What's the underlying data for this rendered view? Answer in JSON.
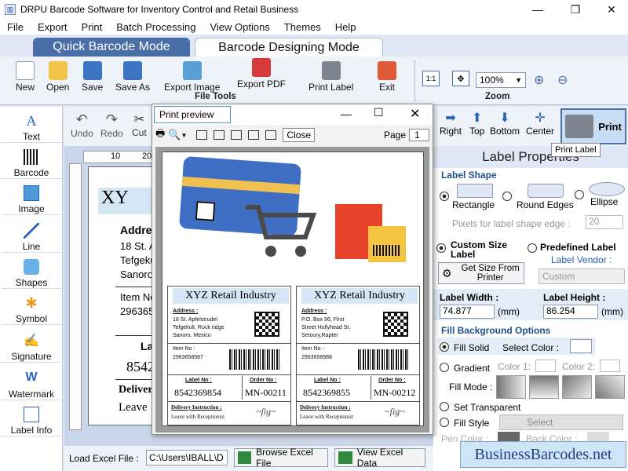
{
  "window": {
    "title": "DRPU Barcode Software for Inventory Control and Retail Business"
  },
  "menu": [
    "File",
    "Export",
    "Print",
    "Batch Processing",
    "View Options",
    "Themes",
    "Help"
  ],
  "modes": {
    "quick": "Quick Barcode Mode",
    "designing": "Barcode Designing Mode"
  },
  "file_tools": {
    "group": "File Tools",
    "new": "New",
    "open": "Open",
    "save": "Save",
    "save_as": "Save As",
    "export_image": "Export Image",
    "export_pdf": "Export PDF",
    "print_label": "Print Label",
    "exit": "Exit"
  },
  "zoom": {
    "group": "Zoom",
    "value": "100%"
  },
  "edit_tools": {
    "undo": "Undo",
    "redo": "Redo",
    "cut": "Cut"
  },
  "nav_tools": {
    "right": "Right",
    "top": "Top",
    "bottom": "Bottom",
    "center": "Center",
    "print": "Print",
    "tooltip": "Print Label"
  },
  "left_tools": [
    "Text",
    "Barcode",
    "Image",
    "Line",
    "Shapes",
    "Symbol",
    "Signature",
    "Watermark",
    "Label Info"
  ],
  "ruler": {
    "marks": [
      "10",
      "20"
    ]
  },
  "canvas": {
    "company_prefix": "XY",
    "address_prefix": "Addres",
    "addr1": "18 St. A",
    "addr2": "Tefgeku",
    "addr3": "Sanoro",
    "item_prefix": "Item No",
    "item_val": "296365",
    "label_prefix": "La",
    "label_val": "8542",
    "delivery_prefix": "Deliver",
    "leave_prefix": "Leave"
  },
  "preview": {
    "title": "Print preview",
    "close": "Close",
    "page_label": "Page",
    "page_value": "1"
  },
  "labels": [
    {
      "company": "XYZ Retail Industry",
      "address_label": "Address :",
      "address_lines": [
        "18 St. Apfelstrudel",
        "Tefgekult, Rock ridge",
        "Sanoro, Mexico"
      ],
      "item_label": "Item No :",
      "item_no": "2963658987",
      "label_no_label": "Label No :",
      "label_no": "8542369854",
      "order_no_label": "Order No :",
      "order_no": "MN-00211",
      "delivery_label": "Delivery Instruction :",
      "delivery_text": "Leave with Receptionist"
    },
    {
      "company": "XYZ Retail Industry",
      "address_label": "Address :",
      "address_lines": [
        "P.O. Box 96, First",
        "Street Hollyhead St.",
        "Setoury,Rapter"
      ],
      "item_label": "Item No :",
      "item_no": "2963658988",
      "label_no_label": "Label No :",
      "label_no": "8542369855",
      "order_no_label": "Order No :",
      "order_no": "MN-00212",
      "delivery_label": "Delivery Instruction :",
      "delivery_text": "Leave with Receptionist"
    }
  ],
  "properties": {
    "title": "Label Properties",
    "shape_heading": "Label Shape",
    "shapes": [
      "Rectangle",
      "Round Edges",
      "Ellipse"
    ],
    "pixels_label": "Pixels for label shape edge :",
    "pixels_value": "20",
    "custom_size": "Custom Size Label",
    "predefined": "Predefined Label",
    "vendor_label": "Label Vendor :",
    "get_size": "Get Size From Printer",
    "vendor_value": "Custom",
    "width_label": "Label Width :",
    "width_value": "74.877",
    "height_label": "Label Height :",
    "height_value": "86.254",
    "unit": "(mm)",
    "fill_heading": "Fill Background Options",
    "fill_solid": "Fill Solid",
    "select_color": "Select Color :",
    "gradient": "Gradient",
    "color1": "Color 1:",
    "color2": "Color 2:",
    "fill_mode": "Fill Mode :",
    "transparent": "Set Transparent",
    "fill_style": "Fill Style",
    "select": "Select",
    "pen_color": "Pen Color :",
    "back_color": "Back Color :"
  },
  "bottom": {
    "load_excel": "Load Excel File :",
    "path": "C:\\Users\\IBALL\\D",
    "browse": "Browse Excel File",
    "view": "View Excel Data"
  },
  "watermark": "BusinessBarcodes.net",
  "colors": {
    "accent": "#2a63b8",
    "tab_active": "#3b67a8",
    "header_blue": "#d3e7f5"
  }
}
